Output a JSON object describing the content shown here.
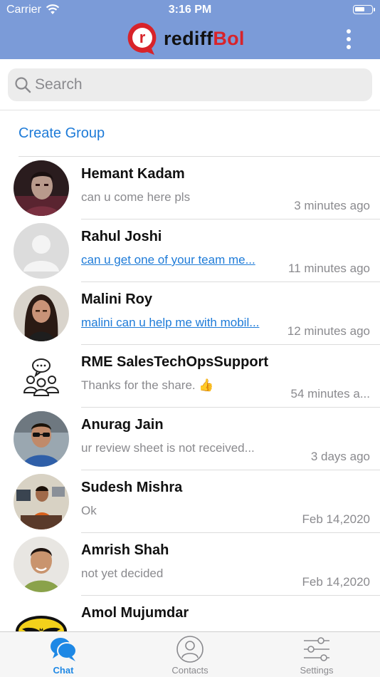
{
  "status_bar": {
    "carrier": "Carrier",
    "time": "3:16 PM",
    "battery_level": 0.6
  },
  "header": {
    "logo_text_a": "rediff",
    "logo_text_b": "Bol",
    "logo_badge_letter": "r",
    "background_color": "#7b9bd8",
    "menu_icon": "more-vertical-icon"
  },
  "search": {
    "placeholder": "Search",
    "value": ""
  },
  "create_group_label": "Create Group",
  "chats": [
    {
      "name": "Hemant Kadam",
      "preview": "can u come here pls",
      "time": "3 minutes ago",
      "is_link": false,
      "avatar": "photo-dark-portrait"
    },
    {
      "name": "Rahul Joshi",
      "preview": "can u get one of your team me...",
      "time": "11 minutes ago",
      "is_link": true,
      "avatar": "default-person-icon"
    },
    {
      "name": "Malini Roy",
      "preview": "malini can u help me with mobil...",
      "time": "12 minutes ago",
      "is_link": true,
      "avatar": "photo-woman-portrait"
    },
    {
      "name": "RME SalesTechOpsSupport",
      "preview": "Thanks for the share. 👍",
      "time": "54 minutes a...",
      "is_link": false,
      "avatar": "group-chat-icon"
    },
    {
      "name": "Anurag Jain",
      "preview": "ur review sheet is not received...",
      "time": "3 days ago",
      "is_link": false,
      "avatar": "photo-man-sunglasses"
    },
    {
      "name": "Sudesh Mishra",
      "preview": "Ok",
      "time": "Feb 14,2020",
      "is_link": false,
      "avatar": "photo-man-office"
    },
    {
      "name": "Amrish Shah",
      "preview": "not yet decided",
      "time": "Feb 14,2020",
      "is_link": false,
      "avatar": "photo-man-smiling"
    },
    {
      "name": "Amol Mujumdar",
      "preview": "",
      "time": "",
      "is_link": false,
      "avatar": "batman-logo"
    }
  ],
  "tabs": [
    {
      "label": "Chat",
      "icon": "chat-bubbles-icon",
      "active": true
    },
    {
      "label": "Contacts",
      "icon": "contact-person-icon",
      "active": false
    },
    {
      "label": "Settings",
      "icon": "sliders-icon",
      "active": false
    }
  ],
  "colors": {
    "accent": "#1e7bd8",
    "brand_red": "#d8232a",
    "header_blue": "#7b9bd8"
  }
}
